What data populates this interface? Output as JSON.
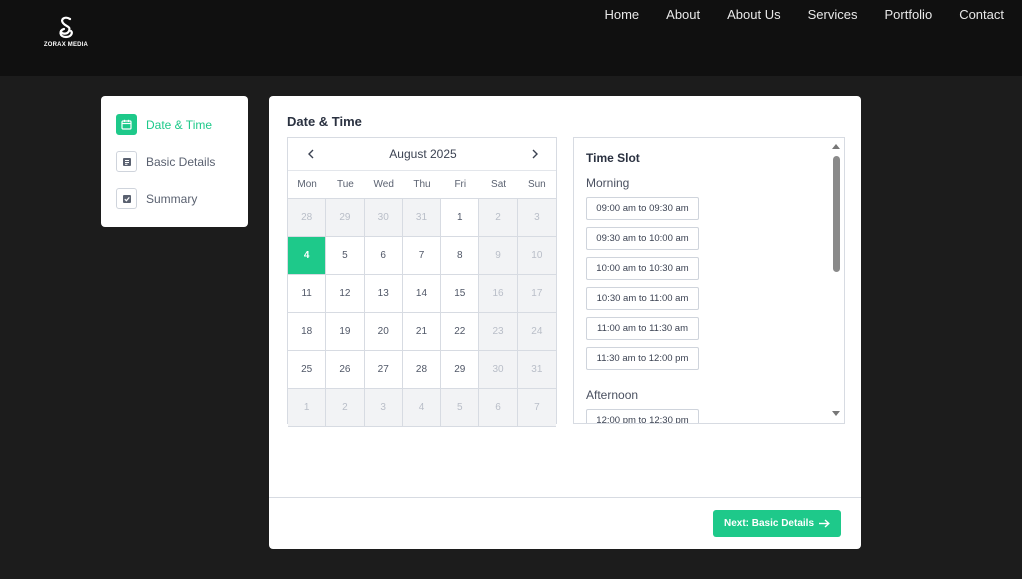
{
  "brand": {
    "name": "ZORAX MEDIA"
  },
  "nav": {
    "items": [
      "Home",
      "About",
      "About Us",
      "Services",
      "Portfolio",
      "Contact"
    ]
  },
  "steps": [
    {
      "label": "Date & Time",
      "icon": "calendar-icon",
      "active": true
    },
    {
      "label": "Basic Details",
      "icon": "document-icon",
      "active": false
    },
    {
      "label": "Summary",
      "icon": "checklist-icon",
      "active": false
    }
  ],
  "main": {
    "title": "Date & Time"
  },
  "calendar": {
    "month": "August 2025",
    "weekdays": [
      "Mon",
      "Tue",
      "Wed",
      "Thu",
      "Fri",
      "Sat",
      "Sun"
    ],
    "selected": "4",
    "days": [
      "28",
      "29",
      "30",
      "31",
      "1",
      "2",
      "3",
      "4",
      "5",
      "6",
      "7",
      "8",
      "9",
      "10",
      "11",
      "12",
      "13",
      "14",
      "15",
      "16",
      "17",
      "18",
      "19",
      "20",
      "21",
      "22",
      "23",
      "24",
      "25",
      "26",
      "27",
      "28",
      "29",
      "30",
      "31",
      "1",
      "2",
      "3",
      "4",
      "5",
      "6",
      "7"
    ]
  },
  "timeslot": {
    "title": "Time Slot",
    "morning_label": "Morning",
    "morning": [
      "09:00 am to 09:30 am",
      "09:30 am to 10:00 am",
      "10:00 am to 10:30 am",
      "10:30 am to 11:00 am",
      "11:00 am to 11:30 am",
      "11:30 am to 12:00 pm"
    ],
    "afternoon_label": "Afternoon",
    "afternoon": [
      "12:00 pm to 12:30 pm"
    ]
  },
  "footer": {
    "next_label": "Next: Basic Details"
  },
  "colors": {
    "accent": "#1ec98a",
    "header": "#101010",
    "background": "#1c1c1c"
  }
}
